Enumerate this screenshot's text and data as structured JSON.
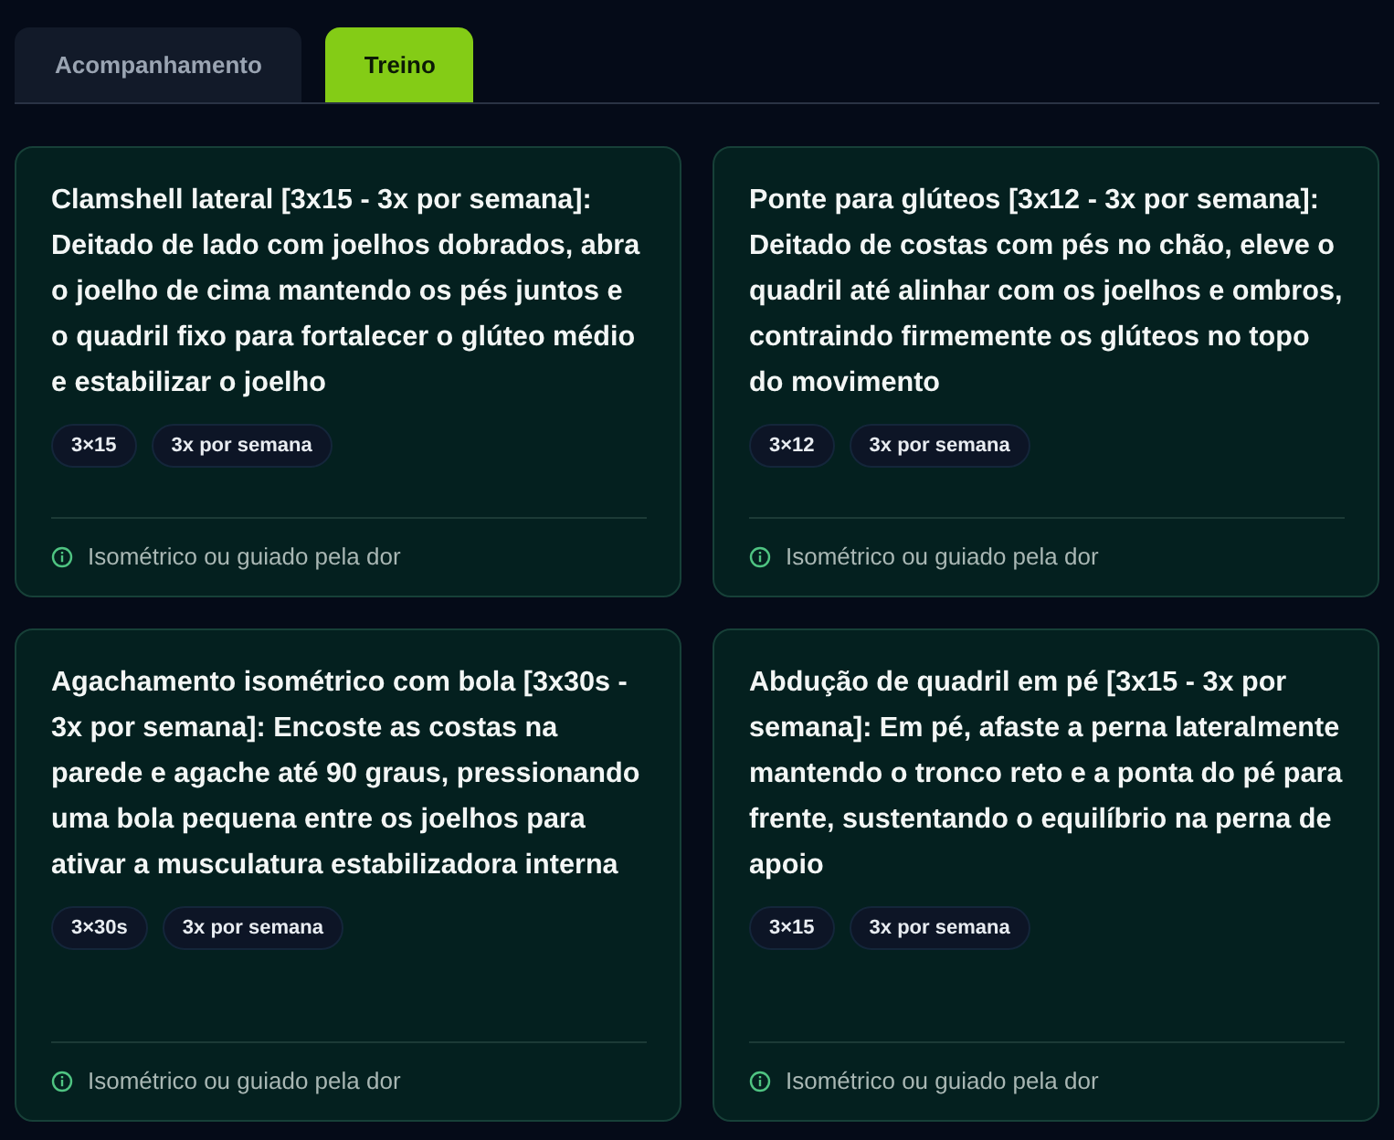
{
  "tabs": [
    {
      "label": "Acompanhamento",
      "selected": false
    },
    {
      "label": "Treino",
      "selected": true
    }
  ],
  "exercises": [
    {
      "description": "Clamshell lateral [3x15 - 3x por semana]: Deitado de lado com joelhos dobrados, abra o joelho de cima mantendo os pés juntos e o quadril fixo para fortalecer o glúteo médio e estabilizar o joelho",
      "tags": [
        "3×15",
        "3x por semana"
      ],
      "note": "Isométrico ou guiado pela dor"
    },
    {
      "description": "Ponte para glúteos [3x12 - 3x por semana]: Deitado de costas com pés no chão, eleve o quadril até alinhar com os joelhos e ombros, contraindo firmemente os glúteos no topo do movimento",
      "tags": [
        "3×12",
        "3x por semana"
      ],
      "note": "Isométrico ou guiado pela dor"
    },
    {
      "description": "Agachamento isométrico com bola [3x30s - 3x por semana]: Encoste as costas na parede e agache até 90 graus, pressionando uma bola pequena entre os joelhos para ativar a musculatura estabilizadora interna",
      "tags": [
        "3×30s",
        "3x por semana"
      ],
      "note": "Isométrico ou guiado pela dor"
    },
    {
      "description": "Abdução de quadril em pé [3x15 - 3x por semana]: Em pé, afaste a perna lateralmente mantendo o tronco reto e a ponta do pé para frente, sustentando o equilíbrio na perna de apoio",
      "tags": [
        "3×15",
        "3x por semana"
      ],
      "note": "Isométrico ou guiado pela dor"
    }
  ]
}
